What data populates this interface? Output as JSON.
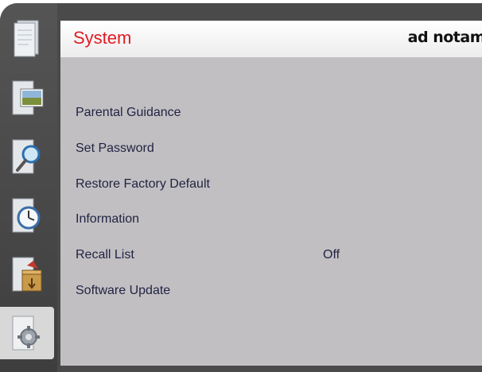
{
  "header": {
    "title": "System",
    "brand": "ad notam"
  },
  "sidebar": {
    "items": [
      {
        "name": "documents-icon",
        "active": false
      },
      {
        "name": "photos-icon",
        "active": false
      },
      {
        "name": "search-icon",
        "active": false
      },
      {
        "name": "clock-icon",
        "active": false
      },
      {
        "name": "installation-box-icon",
        "active": false
      },
      {
        "name": "settings-gear-icon",
        "active": true
      }
    ]
  },
  "menu": {
    "items": [
      {
        "label": "Parental Guidance",
        "value": ""
      },
      {
        "label": "Set Password",
        "value": ""
      },
      {
        "label": "Restore Factory Default",
        "value": ""
      },
      {
        "label": "Information",
        "value": ""
      },
      {
        "label": "Recall List",
        "value": "Off"
      },
      {
        "label": "Software Update",
        "value": ""
      }
    ]
  },
  "colors": {
    "title": "#e21b23",
    "panel": "#c2bfc3",
    "frame": "#4a4a4a",
    "text": "#1f2340"
  }
}
